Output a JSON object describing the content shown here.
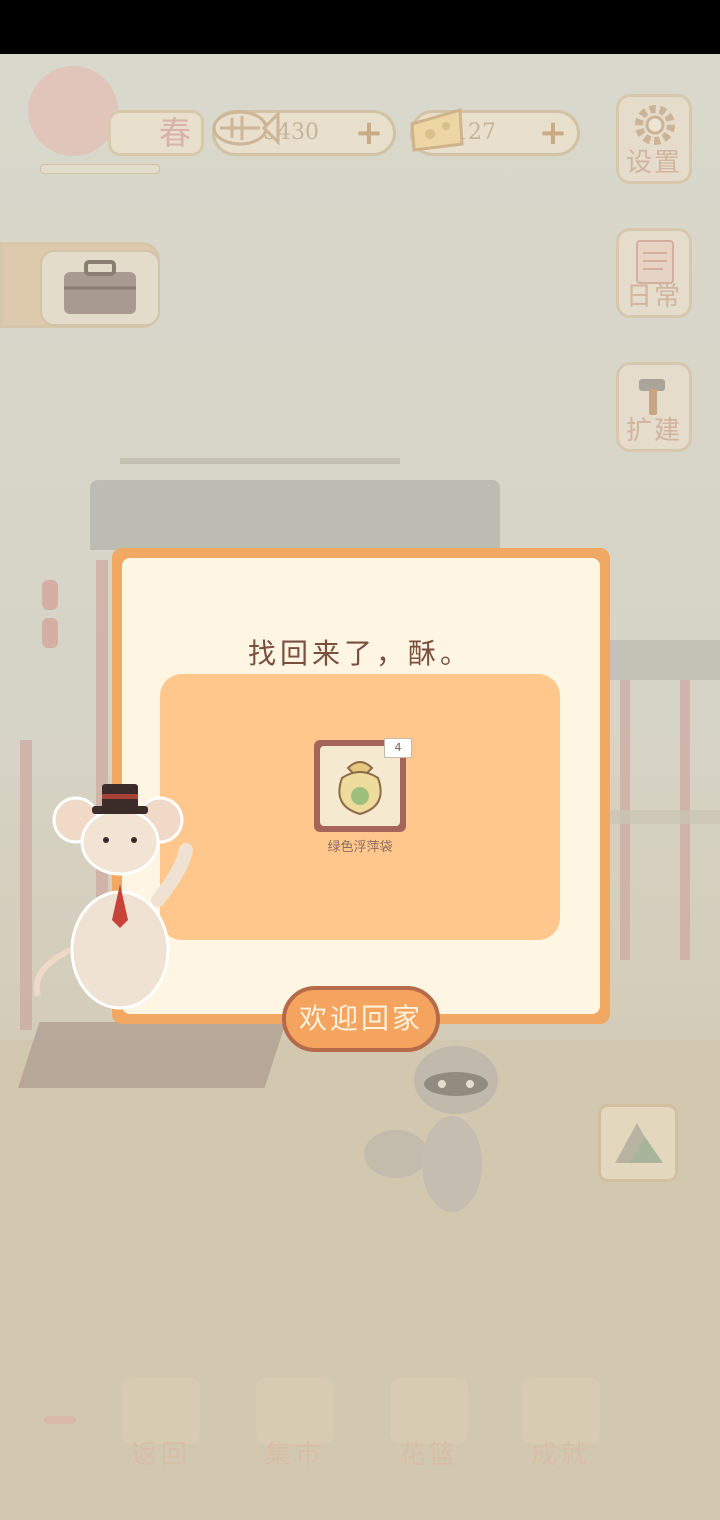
{
  "hud": {
    "season_label": "春",
    "fish_amount": "35430",
    "cheese_amount": "127",
    "plus_label": "+"
  },
  "side_menu": {
    "settings_label": "设置",
    "diary_label": "日常",
    "build_label": "扩建"
  },
  "dialog": {
    "title": "找回来了，酥。",
    "item": {
      "name": "绿色浮萍袋",
      "count": "4"
    },
    "confirm_label": "欢迎回家"
  },
  "bottom_nav": {
    "items": [
      {
        "label": "返回"
      },
      {
        "label": "集市"
      },
      {
        "label": "花篮"
      },
      {
        "label": "成就"
      }
    ]
  },
  "colors": {
    "dialog_border": "#f1a862",
    "dialog_bg": "#fef6e2",
    "reward_panel": "#ffc78b",
    "button_bg": "#f4a45f",
    "button_border": "#b56b4a"
  }
}
